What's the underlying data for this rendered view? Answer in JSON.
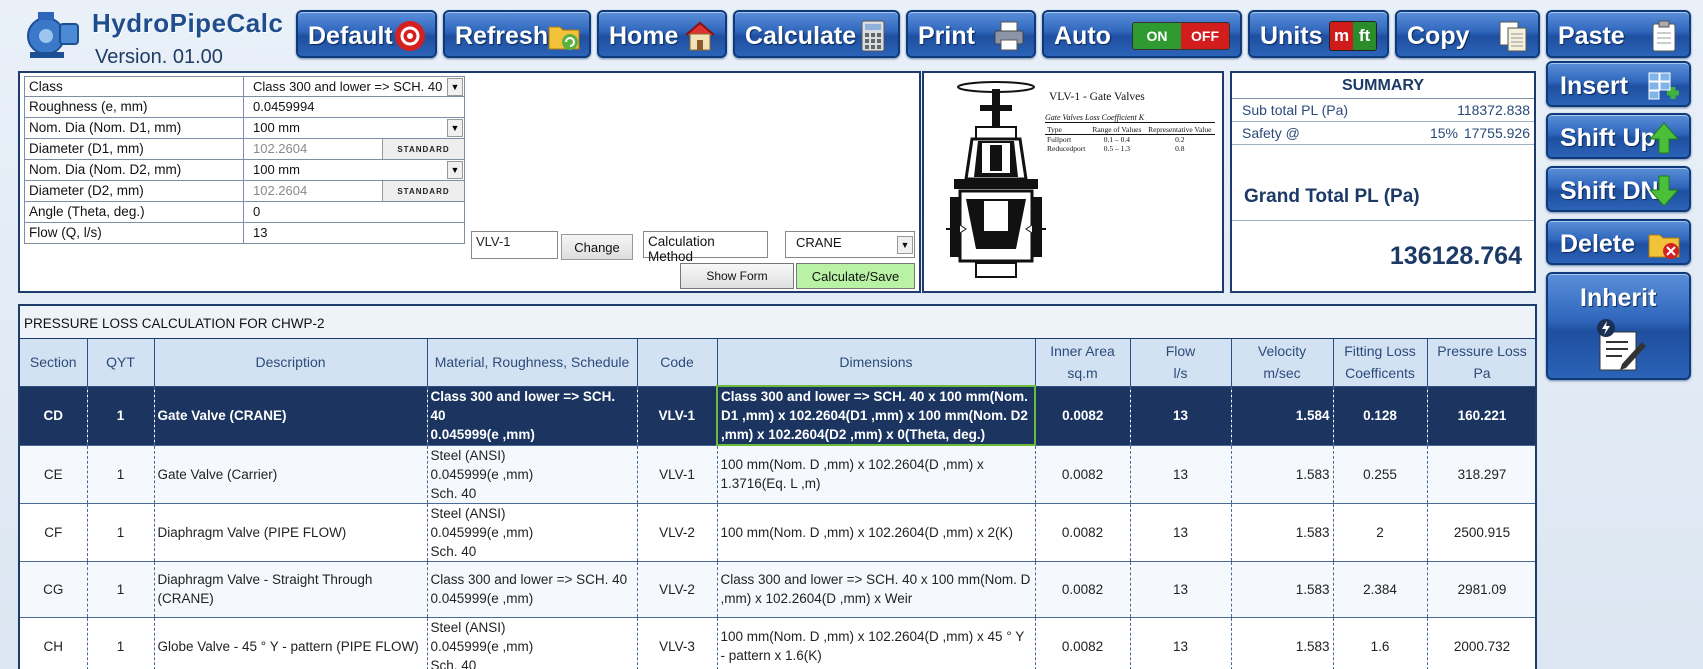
{
  "app": {
    "title": "HydroPipeCalc",
    "version": "Version. 01.00"
  },
  "toolbar": {
    "default": "Default",
    "refresh": "Refresh",
    "home": "Home",
    "calculate": "Calculate",
    "print": "Print",
    "auto": "Auto",
    "auto_on": "ON",
    "auto_off": "OFF",
    "units": "Units",
    "units_m": "m",
    "units_ft": "ft",
    "copy": "Copy",
    "paste": "Paste"
  },
  "side": {
    "insert": "Insert",
    "shift_up": "Shift Up",
    "shift_dn": "Shift DN",
    "delete": "Delete",
    "inherit": "Inherit"
  },
  "form": {
    "rows": [
      {
        "label": "Class",
        "value": "Class 300 and lower => SCH. 40",
        "dropdown": true
      },
      {
        "label": "Roughness (e, mm)",
        "value": "0.0459994"
      },
      {
        "label": "Nom. Dia (Nom. D1, mm)",
        "value": "100 mm",
        "dropdown": true
      },
      {
        "label": "Diameter (D1, mm)",
        "value": "102.2604",
        "grey": true,
        "standard": "STANDARD"
      },
      {
        "label": "Nom. Dia (Nom. D2, mm)",
        "value": "100 mm",
        "dropdown": true
      },
      {
        "label": "Diameter (D2, mm)",
        "value": "102.2604",
        "grey": true,
        "standard": "STANDARD"
      },
      {
        "label": "Angle (Theta, deg.)",
        "value": "0"
      },
      {
        "label": "Flow (Q, l/s)",
        "value": "13"
      }
    ],
    "code": "VLV-1",
    "change_label": "Change",
    "calc_method_label": "Calculation Method",
    "calc_method_value": "CRANE",
    "show_form": "Show Form",
    "calc_save": "Calculate/Save"
  },
  "figure": {
    "caption": "VLV-1 - Gate Valves",
    "k_title": "Gate Valves Loss Coefficient K",
    "k_headers": [
      "Type",
      "Range of Values",
      "Representative Value"
    ],
    "k_rows": [
      [
        "Fullport",
        "0.1 – 0.4",
        "0.2"
      ],
      [
        "Reducedport",
        "0.5 – 1.3",
        "0.8"
      ]
    ]
  },
  "summary": {
    "title": "SUMMARY",
    "subtotal_label": "Sub total PL (Pa)",
    "subtotal_value": "118372.838",
    "safety_label": "Safety @",
    "safety_pct": "15%",
    "safety_value": "17755.926",
    "grand_label": "Grand Total PL (Pa)",
    "grand_value": "136128.764"
  },
  "grid": {
    "caption": "PRESSURE LOSS CALCULATION FOR CHWP-2",
    "headers": [
      "Section",
      "QYT",
      "Description",
      "Material, Roughness, Schedule",
      "Code",
      "Dimensions",
      "Inner Area|sq.m",
      "Flow|l/s",
      "Velocity|m/sec",
      "Fitting Loss|Coefficents",
      "Pressure Loss|Pa"
    ],
    "rows": [
      [
        "CD",
        "1",
        "Gate Valve (CRANE)",
        "Class 300 and lower => SCH. 40\n0.045999(e ,mm)",
        "VLV-1",
        "Class 300 and lower => SCH. 40 x 100 mm(Nom. D1 ,mm) x 102.2604(D1 ,mm) x 100 mm(Nom. D2 ,mm) x 102.2604(D2 ,mm) x 0(Theta, deg.)",
        "0.0082",
        "13",
        "1.584",
        "0.128",
        "160.221"
      ],
      [
        "CE",
        "1",
        "Gate Valve (Carrier)",
        "Steel (ANSI)\n0.045999(e ,mm)\nSch. 40",
        "VLV-1",
        "100 mm(Nom. D ,mm) x 102.2604(D ,mm) x 1.3716(Eq. L ,m)",
        "0.0082",
        "13",
        "1.583",
        "0.255",
        "318.297"
      ],
      [
        "CF",
        "1",
        "Diaphragm Valve (PIPE FLOW)",
        "Steel (ANSI)\n0.045999(e ,mm)\nSch. 40",
        "VLV-2",
        "100 mm(Nom. D ,mm) x 102.2604(D ,mm) x 2(K)",
        "0.0082",
        "13",
        "1.583",
        "2",
        "2500.915"
      ],
      [
        "CG",
        "1",
        "Diaphragm Valve - Straight Through (CRANE)",
        "Class 300 and lower => SCH. 40\n0.045999(e ,mm)",
        "VLV-2",
        "Class 300 and lower => SCH. 40 x 100 mm(Nom. D ,mm) x 102.2604(D ,mm) x Weir",
        "0.0082",
        "13",
        "1.583",
        "2.384",
        "2981.09"
      ],
      [
        "CH",
        "1",
        "Globe Valve - 45 ° Y - pattern (PIPE FLOW)",
        "Steel (ANSI)\n0.045999(e ,mm)\nSch. 40",
        "VLV-3",
        "100 mm(Nom. D ,mm) x 102.2604(D ,mm) x 45 ° Y - pattern x 1.6(K)",
        "0.0082",
        "13",
        "1.583",
        "1.6",
        "2000.732"
      ]
    ]
  }
}
